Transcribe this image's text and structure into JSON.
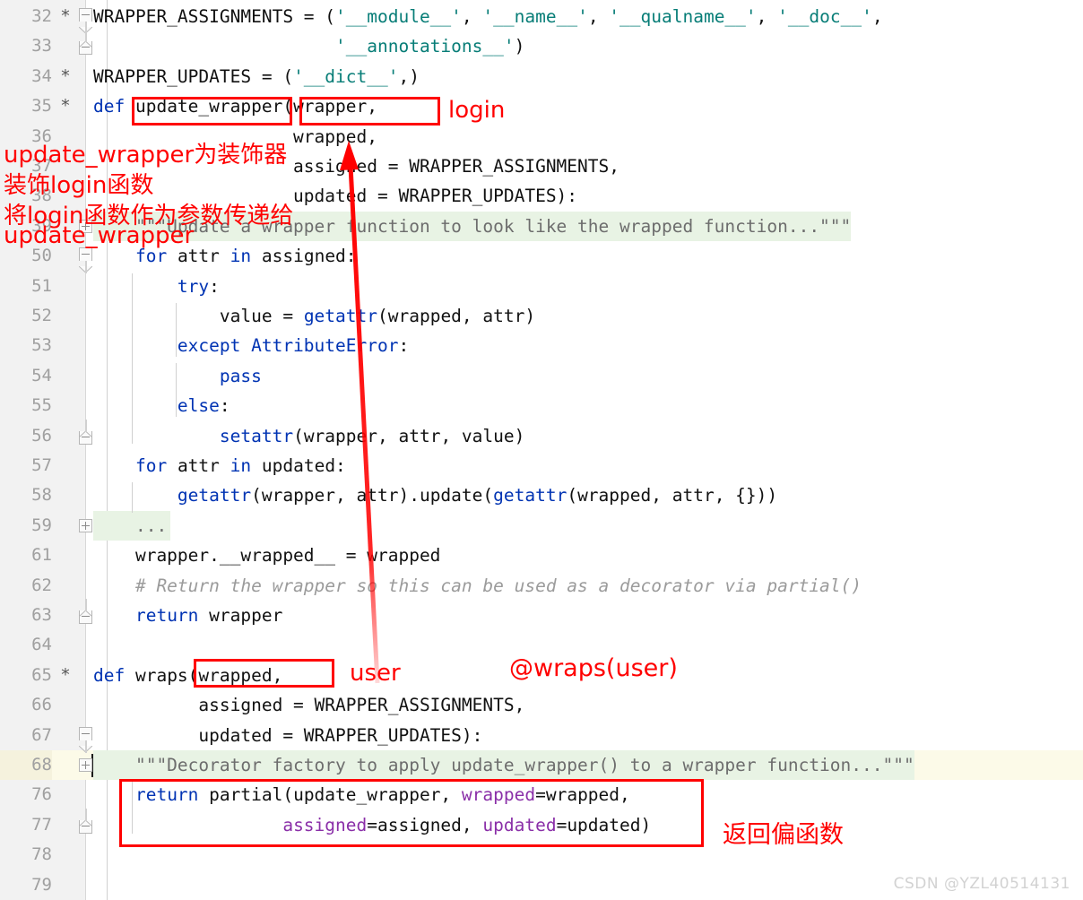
{
  "editor": {
    "language": "python",
    "gutter_bg": "#f2f2f2",
    "highlight_green": "#e8f3e4",
    "highlight_yellow": "#fcfae8",
    "annotation_color": "#ff0000",
    "lines": [
      {
        "num": "32",
        "marker": "*",
        "fold": "arrow-down",
        "highlight": "none",
        "tokens": [
          {
            "t": "WRAPPER_ASSIGNMENTS = (",
            "c": "plain"
          },
          {
            "t": "'__module__'",
            "c": "str"
          },
          {
            "t": ", ",
            "c": "plain"
          },
          {
            "t": "'__name__'",
            "c": "str"
          },
          {
            "t": ", ",
            "c": "plain"
          },
          {
            "t": "'__qualname__'",
            "c": "str"
          },
          {
            "t": ", ",
            "c": "plain"
          },
          {
            "t": "'__doc__'",
            "c": "str"
          },
          {
            "t": ",",
            "c": "plain"
          }
        ]
      },
      {
        "num": "33",
        "marker": "",
        "fold": "arrow-up",
        "highlight": "none",
        "tokens": [
          {
            "t": "                       ",
            "c": "plain"
          },
          {
            "t": "'__annotations__'",
            "c": "str"
          },
          {
            "t": ")",
            "c": "plain"
          }
        ]
      },
      {
        "num": "34",
        "marker": "*",
        "fold": "",
        "highlight": "none",
        "tokens": [
          {
            "t": "WRAPPER_UPDATES = (",
            "c": "plain"
          },
          {
            "t": "'__dict__'",
            "c": "str"
          },
          {
            "t": ",)",
            "c": "plain"
          }
        ]
      },
      {
        "num": "35",
        "marker": "*",
        "fold": "",
        "highlight": "none",
        "tokens": [
          {
            "t": "def ",
            "c": "kw"
          },
          {
            "t": "update_wrapper(wrapper,",
            "c": "plain"
          }
        ]
      },
      {
        "num": "36",
        "marker": "",
        "fold": "",
        "highlight": "none",
        "tokens": [
          {
            "t": "                   wrapped,",
            "c": "plain"
          }
        ]
      },
      {
        "num": "37",
        "marker": "",
        "fold": "",
        "highlight": "none",
        "tokens": [
          {
            "t": "                   assigned = WRAPPER_ASSIGNMENTS,",
            "c": "plain"
          }
        ]
      },
      {
        "num": "38",
        "marker": "",
        "fold": "",
        "highlight": "none",
        "tokens": [
          {
            "t": "                   updated = WRAPPER_UPDATES):",
            "c": "plain"
          }
        ]
      },
      {
        "num": "39",
        "marker": "",
        "fold": "plus",
        "highlight": "green",
        "tokens": [
          {
            "t": "    \"\"\"Update a wrapper function to look like the wrapped function...\"\"\"",
            "c": "doc"
          }
        ]
      },
      {
        "num": "50",
        "marker": "",
        "fold": "arrow-down",
        "highlight": "none",
        "tokens": [
          {
            "t": "    ",
            "c": "plain"
          },
          {
            "t": "for ",
            "c": "kw"
          },
          {
            "t": "attr ",
            "c": "plain"
          },
          {
            "t": "in ",
            "c": "kw"
          },
          {
            "t": "assigned:",
            "c": "plain"
          }
        ]
      },
      {
        "num": "51",
        "marker": "",
        "fold": "",
        "highlight": "none",
        "tokens": [
          {
            "t": "        ",
            "c": "plain"
          },
          {
            "t": "try",
            "c": "kw"
          },
          {
            "t": ":",
            "c": "plain"
          }
        ]
      },
      {
        "num": "52",
        "marker": "",
        "fold": "",
        "highlight": "none",
        "tokens": [
          {
            "t": "            value = ",
            "c": "plain"
          },
          {
            "t": "getattr",
            "c": "kw"
          },
          {
            "t": "(wrapped, attr)",
            "c": "plain"
          }
        ]
      },
      {
        "num": "53",
        "marker": "",
        "fold": "",
        "highlight": "none",
        "tokens": [
          {
            "t": "        ",
            "c": "plain"
          },
          {
            "t": "except AttributeError",
            "c": "kw"
          },
          {
            "t": ":",
            "c": "plain"
          }
        ]
      },
      {
        "num": "54",
        "marker": "",
        "fold": "",
        "highlight": "none",
        "tokens": [
          {
            "t": "            ",
            "c": "plain"
          },
          {
            "t": "pass",
            "c": "kw"
          }
        ]
      },
      {
        "num": "55",
        "marker": "",
        "fold": "",
        "highlight": "none",
        "tokens": [
          {
            "t": "        ",
            "c": "plain"
          },
          {
            "t": "else",
            "c": "kw"
          },
          {
            "t": ":",
            "c": "plain"
          }
        ]
      },
      {
        "num": "56",
        "marker": "",
        "fold": "arrow-up",
        "highlight": "none",
        "tokens": [
          {
            "t": "            ",
            "c": "plain"
          },
          {
            "t": "setattr",
            "c": "kw"
          },
          {
            "t": "(wrapper, attr, value)",
            "c": "plain"
          }
        ]
      },
      {
        "num": "57",
        "marker": "",
        "fold": "",
        "highlight": "none",
        "tokens": [
          {
            "t": "    ",
            "c": "plain"
          },
          {
            "t": "for ",
            "c": "kw"
          },
          {
            "t": "attr ",
            "c": "plain"
          },
          {
            "t": "in ",
            "c": "kw"
          },
          {
            "t": "updated:",
            "c": "plain"
          }
        ]
      },
      {
        "num": "58",
        "marker": "",
        "fold": "",
        "highlight": "none",
        "tokens": [
          {
            "t": "        ",
            "c": "plain"
          },
          {
            "t": "getattr",
            "c": "kw"
          },
          {
            "t": "(wrapper, attr).update(",
            "c": "plain"
          },
          {
            "t": "getattr",
            "c": "kw"
          },
          {
            "t": "(wrapped, attr, {}))",
            "c": "plain"
          }
        ]
      },
      {
        "num": "59",
        "marker": "",
        "fold": "plus",
        "highlight": "green-short",
        "tokens": [
          {
            "t": "    ...",
            "c": "doc"
          }
        ]
      },
      {
        "num": "61",
        "marker": "",
        "fold": "",
        "highlight": "none",
        "tokens": [
          {
            "t": "    wrapper.__wrapped__ = wrapped",
            "c": "plain"
          }
        ]
      },
      {
        "num": "62",
        "marker": "",
        "fold": "",
        "highlight": "none",
        "tokens": [
          {
            "t": "    # Return the wrapper so this can be used as a decorator via partial()",
            "c": "cmt"
          }
        ]
      },
      {
        "num": "63",
        "marker": "",
        "fold": "arrow-up",
        "highlight": "none",
        "tokens": [
          {
            "t": "    ",
            "c": "plain"
          },
          {
            "t": "return ",
            "c": "kw"
          },
          {
            "t": "wrapper",
            "c": "plain"
          }
        ]
      },
      {
        "num": "64",
        "marker": "",
        "fold": "",
        "highlight": "none",
        "tokens": []
      },
      {
        "num": "65",
        "marker": "*",
        "fold": "",
        "highlight": "none",
        "tokens": [
          {
            "t": "def ",
            "c": "kw"
          },
          {
            "t": "wraps(wrapped,",
            "c": "plain"
          }
        ]
      },
      {
        "num": "66",
        "marker": "",
        "fold": "",
        "highlight": "none",
        "tokens": [
          {
            "t": "          assigned = WRAPPER_ASSIGNMENTS,",
            "c": "plain"
          }
        ]
      },
      {
        "num": "67",
        "marker": "",
        "fold": "arrow-down",
        "highlight": "none",
        "tokens": [
          {
            "t": "          updated = WRAPPER_UPDATES):",
            "c": "plain"
          }
        ]
      },
      {
        "num": "68",
        "marker": "",
        "fold": "plus",
        "highlight": "yellow-green",
        "caret": true,
        "tokens": [
          {
            "t": "    \"\"\"Decorator factory to apply update_wrapper() to a wrapper function...\"\"\"",
            "c": "doc"
          }
        ]
      },
      {
        "num": "76",
        "marker": "",
        "fold": "",
        "highlight": "none",
        "tokens": [
          {
            "t": "    ",
            "c": "plain"
          },
          {
            "t": "return ",
            "c": "kw"
          },
          {
            "t": "partial(update_wrapper, ",
            "c": "plain"
          },
          {
            "t": "wrapped",
            "c": "kwarg"
          },
          {
            "t": "=wrapped,",
            "c": "plain"
          }
        ]
      },
      {
        "num": "77",
        "marker": "",
        "fold": "arrow-up",
        "highlight": "none",
        "tokens": [
          {
            "t": "                  ",
            "c": "plain"
          },
          {
            "t": "assigned",
            "c": "kwarg"
          },
          {
            "t": "=assigned, ",
            "c": "plain"
          },
          {
            "t": "updated",
            "c": "kwarg"
          },
          {
            "t": "=updated)",
            "c": "plain"
          }
        ]
      },
      {
        "num": "78",
        "marker": "",
        "fold": "",
        "highlight": "none",
        "tokens": []
      },
      {
        "num": "79",
        "marker": "",
        "fold": "",
        "highlight": "none",
        "tokens": []
      }
    ]
  },
  "annotations": {
    "label_login": "login",
    "label_user": "user",
    "label_wraps_user": "@wraps(user)",
    "note_line1": "update_wrapper为装饰器",
    "note_line2": "装饰login函数",
    "note_line3": "将login函数作为参数传递给",
    "note_line4": "update_wrapper",
    "note_return_partial": "返回偏函数"
  },
  "watermark": {
    "text": "CSDN @YZL40514131"
  }
}
